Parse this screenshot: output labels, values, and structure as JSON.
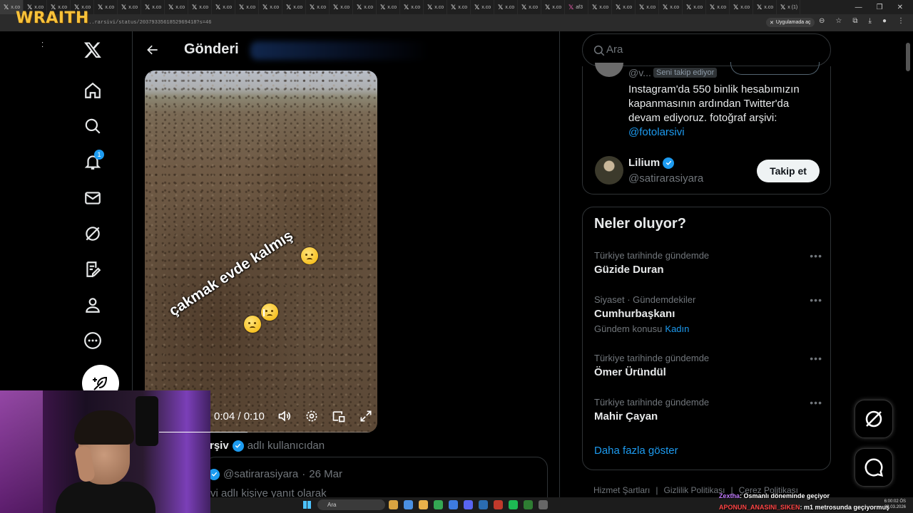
{
  "browser": {
    "tabs": [
      "x.co",
      "x.co",
      "x.co",
      "x.co",
      "x.co",
      "x.co",
      "x.co",
      "x.co",
      "x.co",
      "x.co",
      "x.co",
      "x.co",
      "x.co",
      "x.co",
      "x.co",
      "x.co",
      "x.co",
      "x.co",
      "x.co",
      "x.co",
      "x.co",
      "x.co",
      "x.co",
      "x.co",
      "af3",
      "x.co",
      "x.co",
      "x.co",
      "x.co",
      "x.co",
      "x.co",
      "x.co",
      "x.co",
      "x (1)"
    ],
    "url": "...rarsivi/status/2037933561852969418?s=46",
    "open_app_label": "Uygulamada aç"
  },
  "stream_logo": "WRAITH",
  "nav": {
    "notification_count": "1",
    "icons": [
      "x-logo",
      "home-icon",
      "search-icon",
      "bell-icon",
      "mail-icon",
      "grok-icon",
      "compose-list-icon",
      "profile-icon",
      "more-icon",
      "post-icon"
    ]
  },
  "main": {
    "title": "Gönderi",
    "video": {
      "overlay_text": "çakmak evde kalmış",
      "time": "0:04 / 0:10",
      "progress": 0.4
    },
    "byline": {
      "name": "rşiv",
      "suffix": "adlı kullanıcıdan"
    },
    "quote": {
      "handle": "@satirarasiyara",
      "date": "26 Mar",
      "reply_text": "vi adlı kişiye yanıt olarak"
    }
  },
  "search": {
    "placeholder": "Ara"
  },
  "who_to_follow": {
    "first": {
      "handle": "@v...",
      "follows_you": "Seni takip ediyor",
      "bio": "Instagram'da 550 binlik hesabımızın kapanmasının ardından Twitter'da devam ediyoruz. fotoğraf arşivi:",
      "bio_link": "@fotolarsivi"
    },
    "second": {
      "name": "Lilium",
      "handle": "@satirarasiyara",
      "follow_label": "Takip et"
    }
  },
  "trends": {
    "title": "Neler oluyor?",
    "items": [
      {
        "context": "Türkiye tarihinde gündemde",
        "title": "Güzide Duran",
        "extra_label": "",
        "extra_link": ""
      },
      {
        "context": "Siyaset · Gündemdekiler",
        "title": "Cumhurbaşkanı",
        "extra_label": "Gündem konusu",
        "extra_link": "Kadın"
      },
      {
        "context": "Türkiye tarihinde gündemde",
        "title": "Ömer Üründül",
        "extra_label": "",
        "extra_link": ""
      },
      {
        "context": "Türkiye tarihinde gündemde",
        "title": "Mahir Çayan",
        "extra_label": "",
        "extra_link": ""
      }
    ],
    "show_more": "Daha fazla göster"
  },
  "footer": [
    "Hizmet Şartları",
    "|",
    "Gizlilik Politikası",
    "|",
    "Çerez Politikası"
  ],
  "taskbar": {
    "search": "Ara",
    "time": "6:00:02 ÖS",
    "date": "28.03.2026"
  },
  "chat": [
    {
      "user": "Zextha",
      "message": ": Osmanlı döneminde geçiyor"
    },
    {
      "user": "APONUN_ANASINI_SIKEN",
      "message": ": m1 metrosunda geçiyormuş"
    }
  ]
}
